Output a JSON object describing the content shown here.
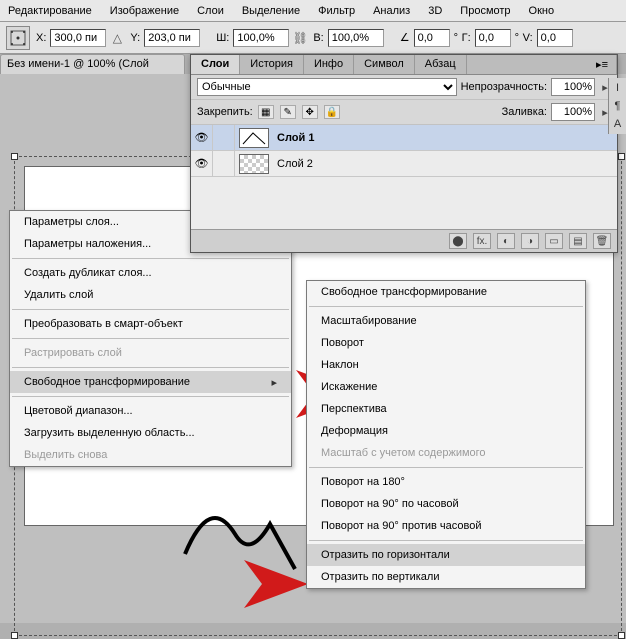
{
  "menubar": [
    "Редактирование",
    "Изображение",
    "Слои",
    "Выделение",
    "Фильтр",
    "Анализ",
    "3D",
    "Просмотр",
    "Окно"
  ],
  "optbar": {
    "x_label": "X:",
    "x_value": "300,0 пи",
    "y_label": "Y:",
    "y_value": "203,0 пи",
    "w_label": "Ш:",
    "w_value": "100,0%",
    "h_label": "В:",
    "h_value": "100,0%",
    "angle_label": "∠",
    "angle_value": "0,0",
    "g_label": "Г:",
    "g_value": "0,0",
    "v_label": "V:",
    "v_value": "0,0"
  },
  "doc_tab": "Без имени-1 @ 100% (Слой",
  "ctx_menu_1": [
    {
      "label": "Параметры слоя...",
      "type": "item"
    },
    {
      "label": "Параметры наложения...",
      "type": "item"
    },
    {
      "type": "sep"
    },
    {
      "label": "Создать дубликат слоя...",
      "type": "item"
    },
    {
      "label": "Удалить слой",
      "type": "item"
    },
    {
      "type": "sep"
    },
    {
      "label": "Преобразовать в смарт-объект",
      "type": "item"
    },
    {
      "type": "sep"
    },
    {
      "label": "Растрировать слой",
      "type": "item",
      "disabled": true
    },
    {
      "type": "sep"
    },
    {
      "label": "Свободное трансформирование",
      "type": "item",
      "hl": true,
      "sub": true
    },
    {
      "type": "sep"
    },
    {
      "label": "Цветовой диапазон...",
      "type": "item"
    },
    {
      "label": "Загрузить выделенную область...",
      "type": "item"
    },
    {
      "label": "Выделить снова",
      "type": "item",
      "disabled": true
    }
  ],
  "ctx_menu_2": [
    {
      "label": "Свободное трансформирование",
      "type": "item"
    },
    {
      "type": "sep"
    },
    {
      "label": "Масштабирование",
      "type": "item"
    },
    {
      "label": "Поворот",
      "type": "item"
    },
    {
      "label": "Наклон",
      "type": "item"
    },
    {
      "label": "Искажение",
      "type": "item"
    },
    {
      "label": "Перспектива",
      "type": "item"
    },
    {
      "label": "Деформация",
      "type": "item"
    },
    {
      "label": "Масштаб с учетом содержимого",
      "type": "item",
      "disabled": true
    },
    {
      "type": "sep"
    },
    {
      "label": "Поворот на 180°",
      "type": "item"
    },
    {
      "label": "Поворот на 90° по часовой",
      "type": "item"
    },
    {
      "label": "Поворот на 90° против часовой",
      "type": "item"
    },
    {
      "type": "sep"
    },
    {
      "label": "Отразить по горизонтали",
      "type": "item",
      "hl": true
    },
    {
      "label": "Отразить по вертикали",
      "type": "item"
    }
  ],
  "layers_panel": {
    "tabs": [
      "Слои",
      "История",
      "Инфо",
      "Символ",
      "Абзац"
    ],
    "active_tab": 0,
    "blend_mode": "Обычные",
    "opacity_label": "Непрозрачность:",
    "opacity_value": "100%",
    "lock_label": "Закрепить:",
    "fill_label": "Заливка:",
    "fill_value": "100%",
    "layers": [
      {
        "name": "Слой 1",
        "selected": true,
        "thumb": "line"
      },
      {
        "name": "Слой 2",
        "selected": false,
        "thumb": "checker"
      }
    ]
  },
  "colors": {
    "arrow": "#d11a1a"
  }
}
